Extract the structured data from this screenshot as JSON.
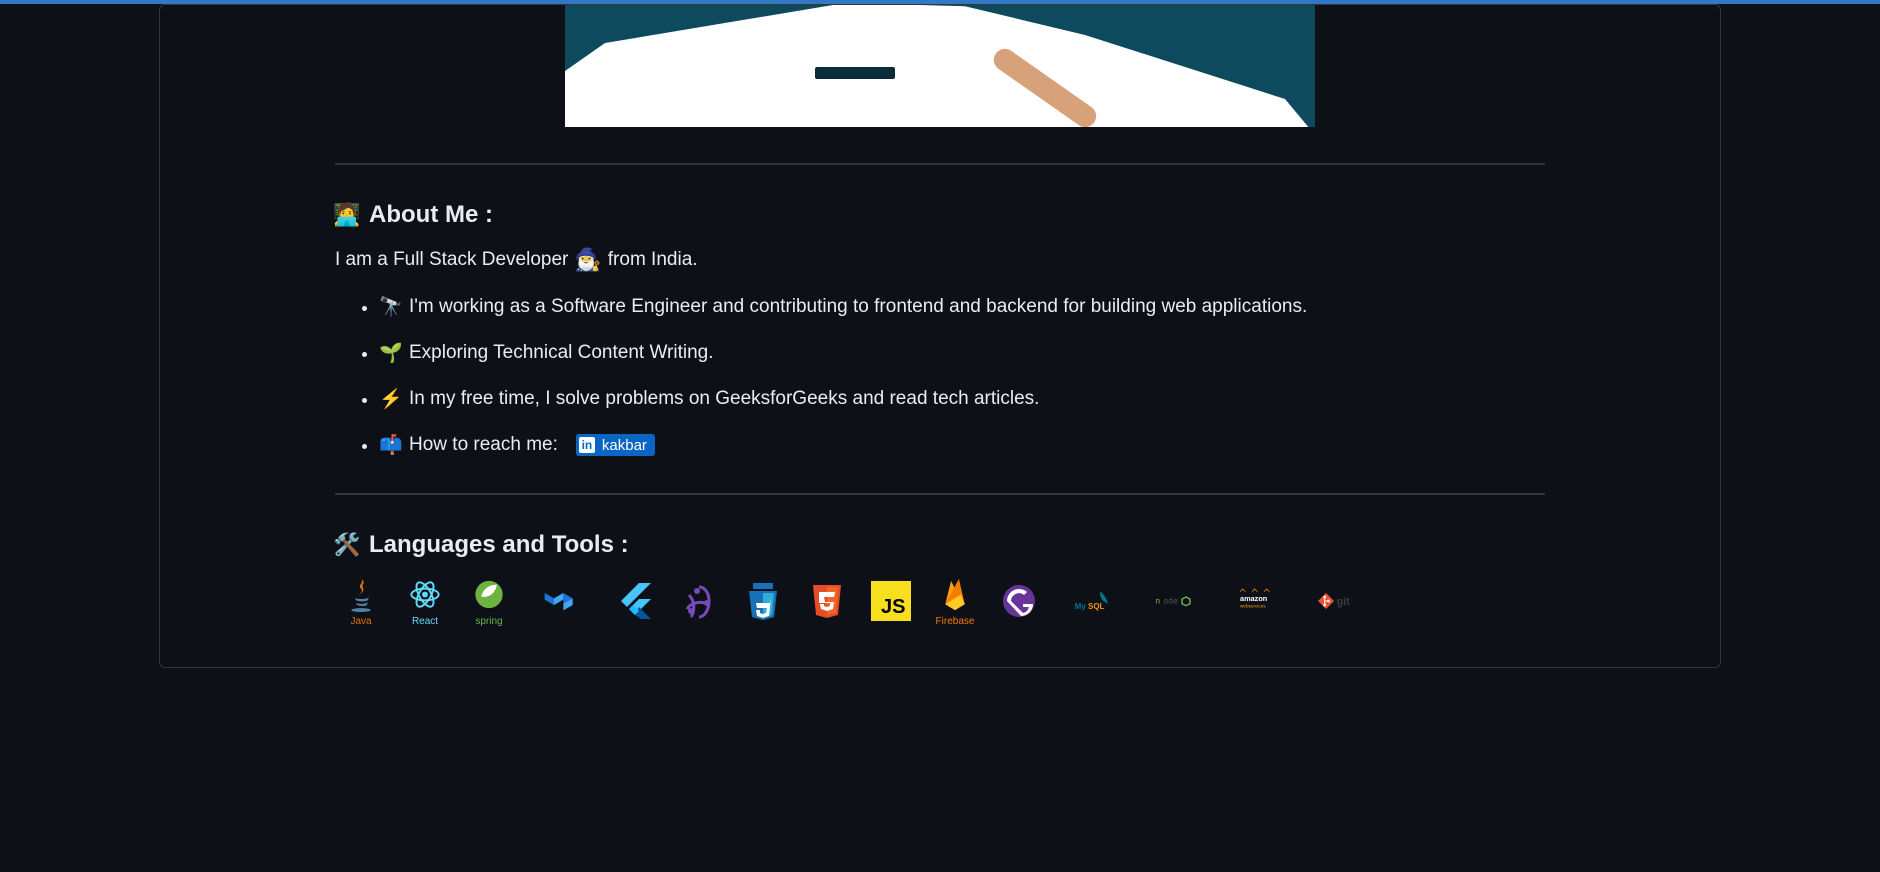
{
  "about": {
    "heading_icon": "🧑‍💻",
    "heading": "About Me :",
    "intro_prefix": "I am a Full Stack Developer",
    "intro_suffix": "from India.",
    "items": [
      {
        "icon": "🔭",
        "text": "I'm working as a Software Engineer and contributing to frontend and backend for building web applications."
      },
      {
        "icon": "🌱",
        "text": "Exploring Technical Content Writing."
      },
      {
        "icon": "⚡",
        "text": "In my free time, I solve problems on GeeksforGeeks and read tech articles."
      },
      {
        "icon": "📫",
        "text": "How to reach me:"
      }
    ],
    "linkedin_badge": "kakbar"
  },
  "tools": {
    "heading_icon": "🛠️",
    "heading": "Languages and Tools :",
    "items": [
      {
        "name": "Java",
        "label": "Java",
        "color": "#e11e22"
      },
      {
        "name": "React",
        "label": "React",
        "color": "#61dafb"
      },
      {
        "name": "Spring",
        "label": "spring",
        "color": "#6db33f"
      },
      {
        "name": "MaterialUI",
        "label": "",
        "color": "#1976d2"
      },
      {
        "name": "Flutter",
        "label": "",
        "color": "#3fb6f3"
      },
      {
        "name": "Redux",
        "label": "",
        "color": "#764abc"
      },
      {
        "name": "CSS3",
        "label": "",
        "color": "#1572b6"
      },
      {
        "name": "HTML5",
        "label": "",
        "color": "#e44d26"
      },
      {
        "name": "JS",
        "label": "",
        "color": "#f7df1e"
      },
      {
        "name": "Firebase",
        "label": "Firebase",
        "color": "#ffa000"
      },
      {
        "name": "Gatsby",
        "label": "",
        "color": "#663399"
      },
      {
        "name": "MySQL",
        "label": "MySQL",
        "color": "#00758f"
      },
      {
        "name": "NodeJS",
        "label": "node",
        "color": "#6cc24a"
      },
      {
        "name": "AWS",
        "label": "amazon",
        "color": "#ff9900"
      },
      {
        "name": "Git",
        "label": "git",
        "color": "#f05133"
      }
    ]
  }
}
